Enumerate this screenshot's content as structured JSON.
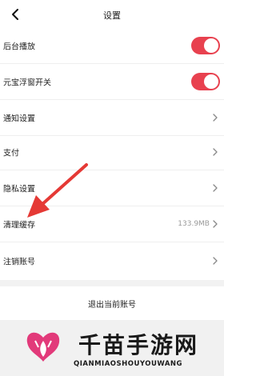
{
  "header": {
    "title": "设置",
    "back_icon": "chevron-left-icon"
  },
  "settings": [
    {
      "label": "后台播放",
      "control": "toggle",
      "on": true
    },
    {
      "label": "元宝浮窗开关",
      "control": "toggle",
      "on": true
    },
    {
      "label": "通知设置",
      "control": "chevron"
    },
    {
      "label": "支付",
      "control": "chevron"
    },
    {
      "label": "隐私设置",
      "control": "chevron"
    },
    {
      "label": "清理缓存",
      "control": "chevron",
      "value": "133.9MB"
    },
    {
      "label": "注销账号",
      "control": "chevron"
    }
  ],
  "logout_label": "退出当前账号",
  "watermark": {
    "title": "千苗手游网",
    "subtitle": "QIANMIAOSHOUYOUWANG"
  },
  "colors": {
    "accent": "#e8414f",
    "annotation_arrow": "#e53935"
  }
}
